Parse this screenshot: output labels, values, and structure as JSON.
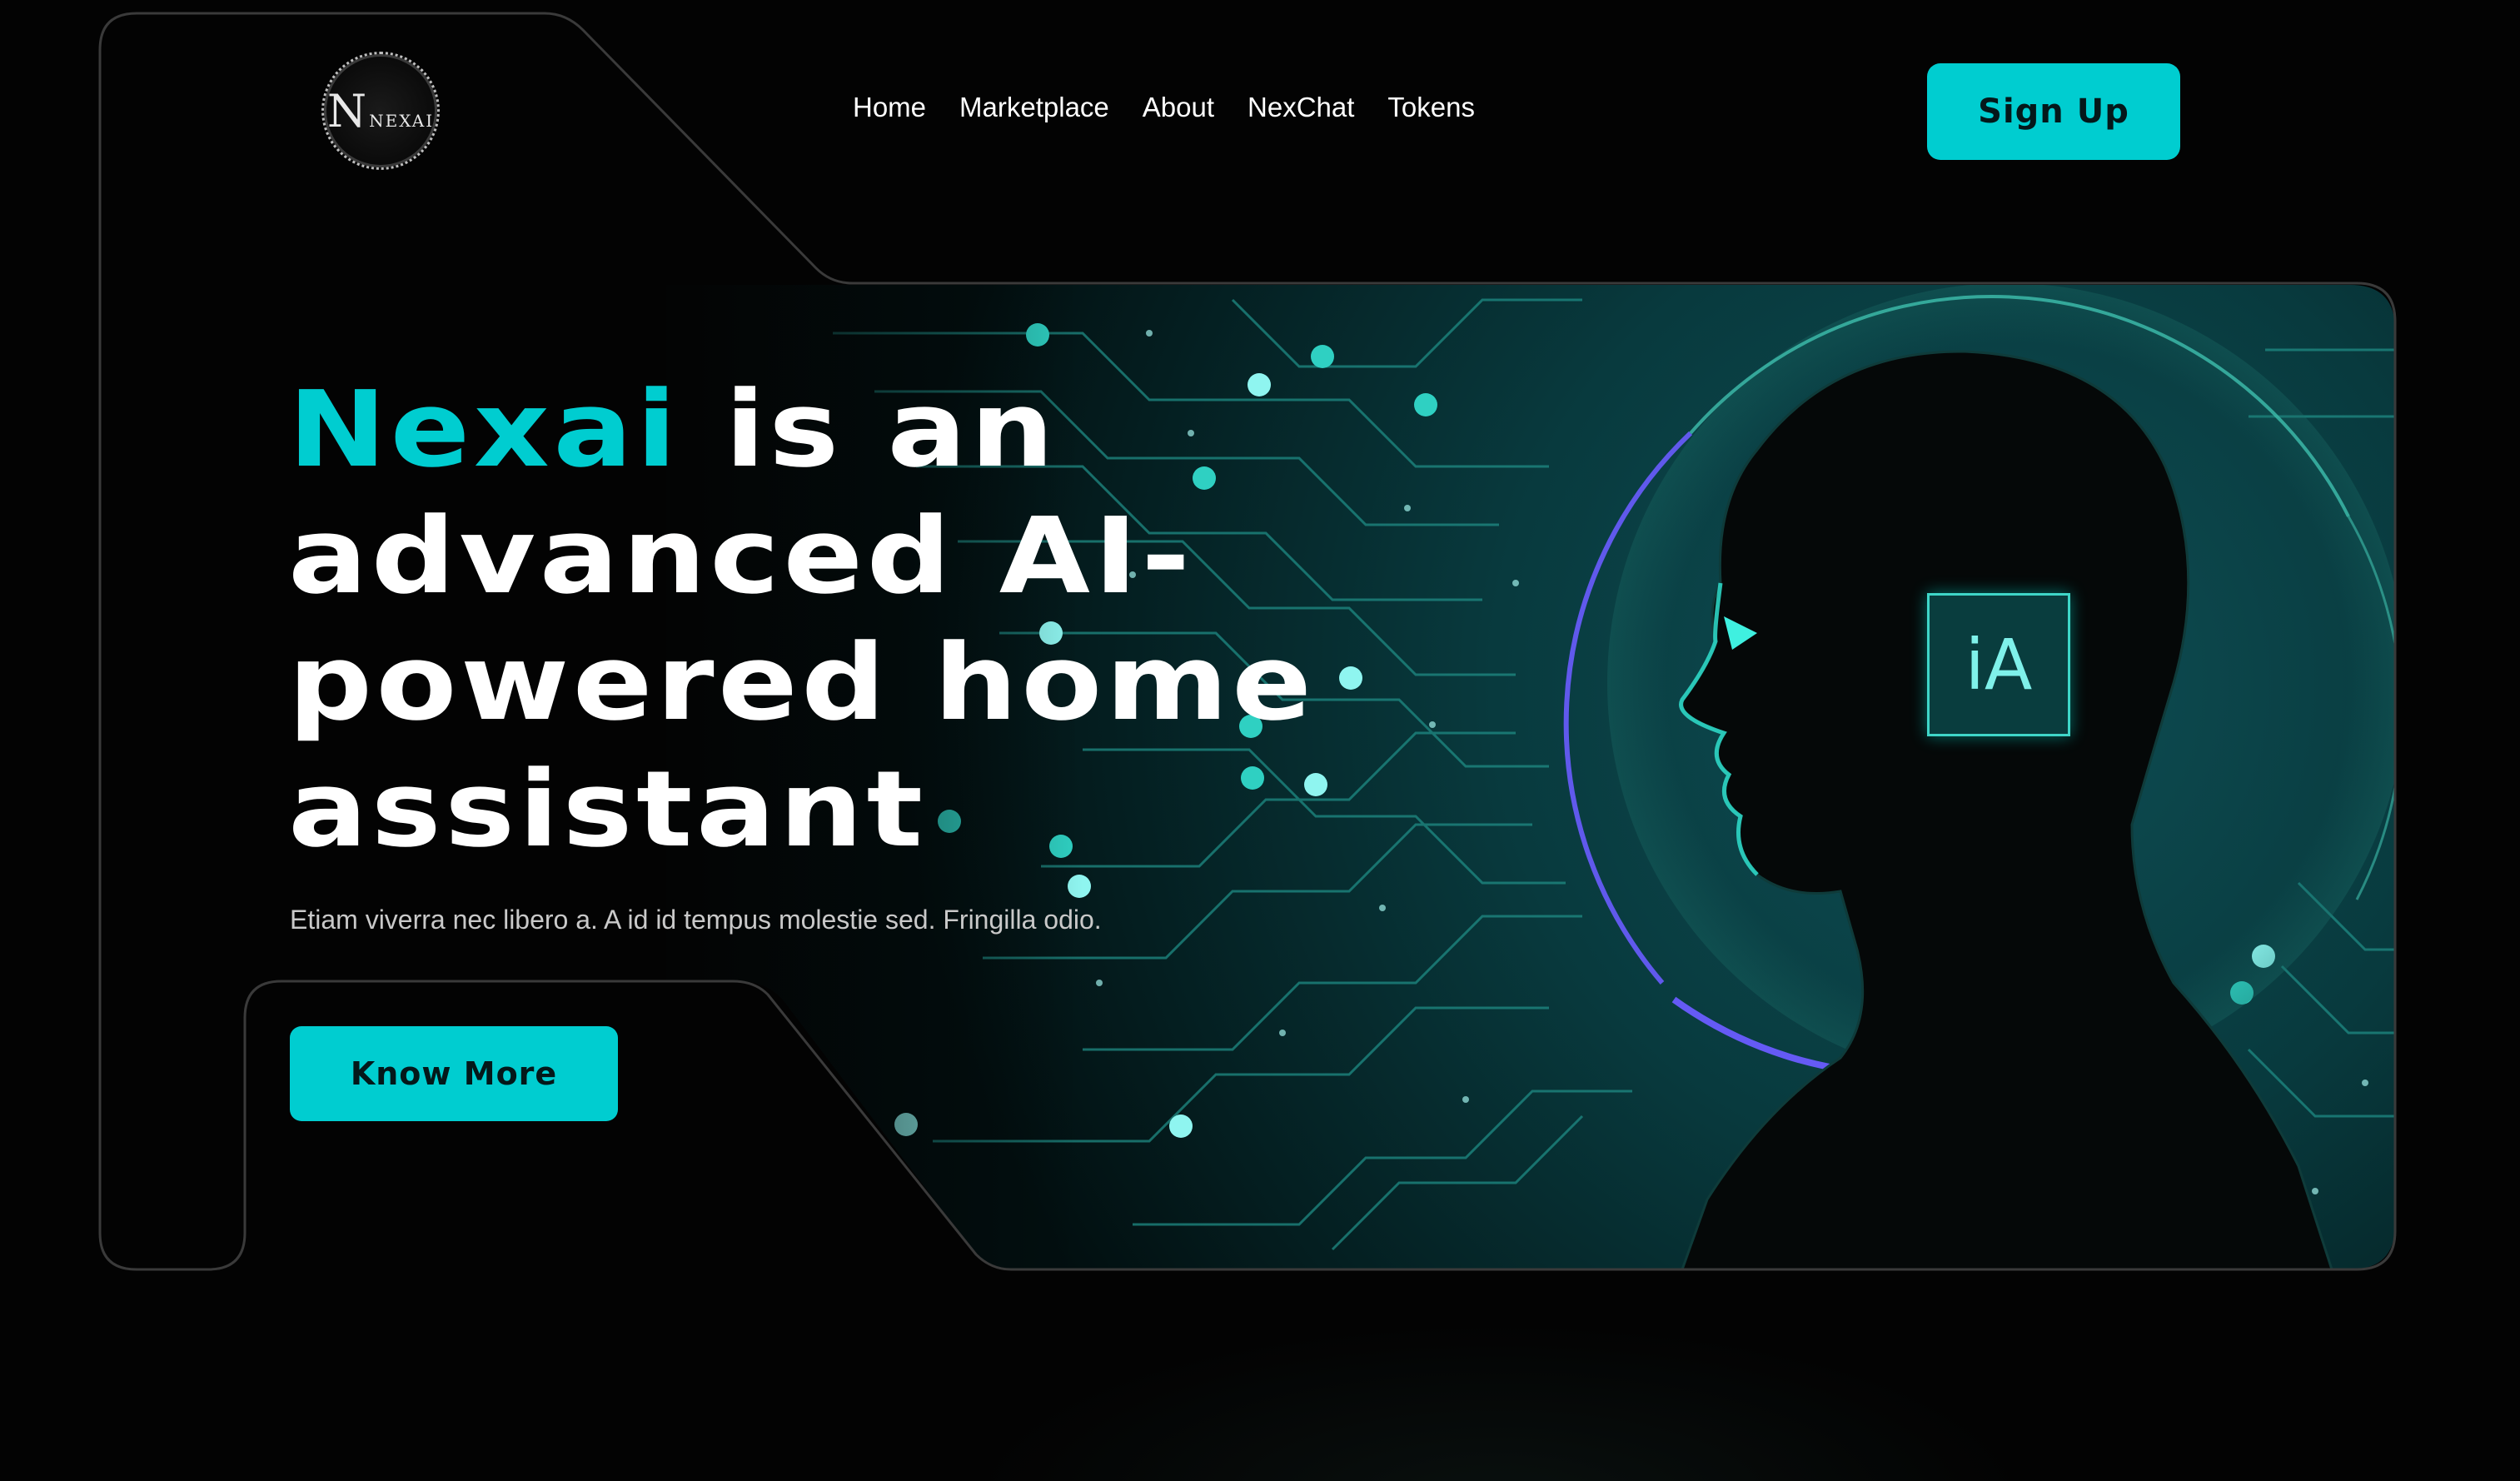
{
  "brand": {
    "logo_big": "N",
    "logo_small": "NEXAI"
  },
  "nav": {
    "items": [
      "Home",
      "Marketplace",
      "About",
      "NexChat",
      "Tokens"
    ],
    "signup_label": "Sign Up"
  },
  "hero": {
    "title_accent": "Nexai",
    "title_rest_line1": " is an",
    "title_line2": "advanced AI-",
    "title_line3": "powered home",
    "title_line4": "assistant",
    "subtitle": "Etiam viverra nec libero a. A id id tempus molestie sed. Fringilla odio.",
    "cta_label": "Know More",
    "chip_label": "iA"
  },
  "colors": {
    "accent": "#00cdd0",
    "background": "#030303",
    "frame_stroke": "#3a3a3a",
    "halo": "#5b4dff"
  }
}
